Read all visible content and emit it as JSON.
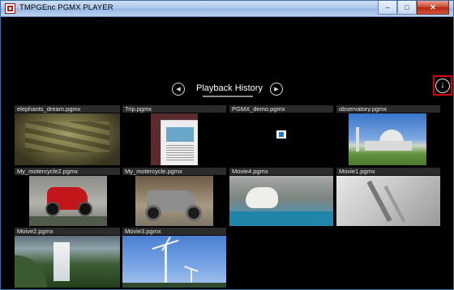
{
  "window": {
    "title": "TMPGEnc PGMX PLAYER",
    "controls": {
      "minimize": "–",
      "maximize": "□",
      "close": "✕"
    }
  },
  "nav": {
    "title": "Playback History",
    "prev_icon": "chevron-left-icon",
    "next_icon": "chevron-right-icon",
    "prev_glyph": "◀",
    "next_glyph": "▶"
  },
  "download_button": {
    "icon": "download-arrow-icon",
    "glyph": "↓",
    "highlight_color": "#d4000b"
  },
  "tiles": [
    {
      "label": "elephants_dream.pgmx"
    },
    {
      "label": "Trip.pgmx"
    },
    {
      "label": "PGMX_demo.pgmx"
    },
    {
      "label": "observatory.pgmx"
    },
    {
      "label": "My_motercycle2.pgmx"
    },
    {
      "label": "My_motercycle.pgmx"
    },
    {
      "label": "Movie4.pgmx"
    },
    {
      "label": "Movie1.pgmx"
    },
    {
      "label": "Moive2.pgmx"
    },
    {
      "label": "Movie3.pgmx"
    }
  ]
}
